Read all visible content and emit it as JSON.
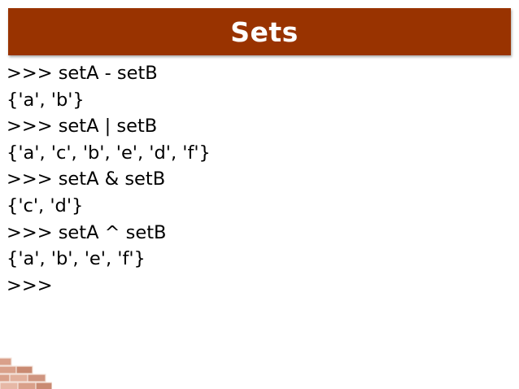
{
  "slide": {
    "title": "Sets",
    "lines": [
      ">>> setA - setB",
      "{'a', 'b'}",
      ">>> setA | setB",
      "{'a', 'c', 'b', 'e', 'd', 'f'}",
      ">>> setA & setB",
      "{'c', 'd'}",
      ">>> setA ^ setB",
      "{'a', 'b', 'e', 'f'}",
      ">>>"
    ]
  },
  "colors": {
    "title_bar": "#993300",
    "title_text": "#ffffff",
    "brick": "#d9a08a"
  },
  "icons": {
    "corner_decoration": "brick-wall-icon"
  }
}
